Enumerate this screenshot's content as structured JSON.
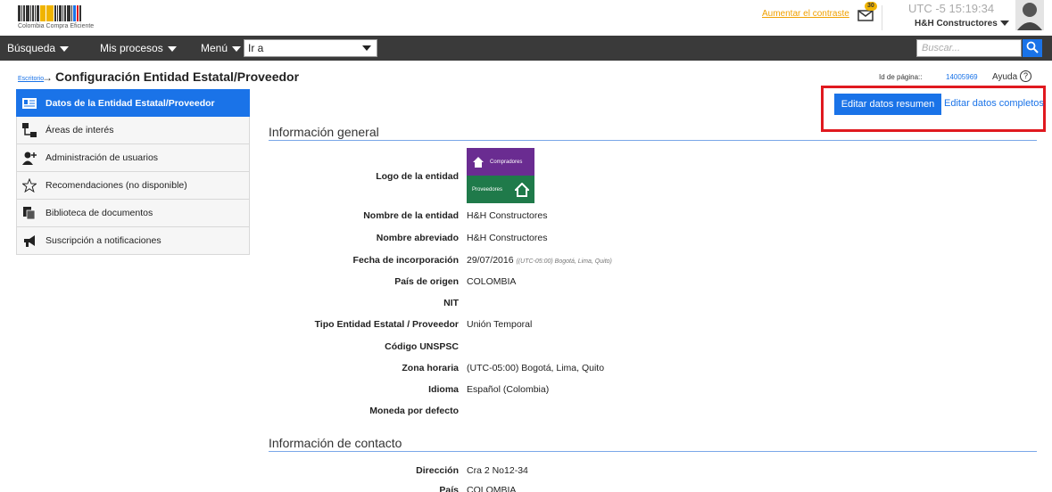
{
  "header": {
    "logo_text": "Colombia Compra Eficiente",
    "contrast_link": "Aumentar el contraste",
    "mail_badge": "30",
    "clock": "UTC -5 15:19:34",
    "user_name": "H&H Constructores"
  },
  "nav": {
    "busqueda": "Búsqueda",
    "mis_procesos": "Mis procesos",
    "menu": "Menú",
    "ir_a": "Ir a",
    "search_placeholder": "Buscar..."
  },
  "breadcrumb": {
    "home": "Escritorio",
    "arrow": "→",
    "title": "Configuración Entidad Estatal/Proveedor"
  },
  "page_meta": {
    "id_label": "Id de página::",
    "id_value": "14005969",
    "help": "Ayuda",
    "help_glyph": "?"
  },
  "sidebar": {
    "items": [
      {
        "label": "Datos de la Entidad Estatal/Proveedor",
        "icon": "id-card-icon"
      },
      {
        "label": "Áreas de interés",
        "icon": "hierarchy-icon"
      },
      {
        "label": "Administración de usuarios",
        "icon": "add-user-icon"
      },
      {
        "label": "Recomendaciones (no disponible)",
        "icon": "star-outline-icon"
      },
      {
        "label": "Biblioteca de documentos",
        "icon": "documents-icon"
      },
      {
        "label": "Suscripción a notificaciones",
        "icon": "megaphone-icon"
      }
    ]
  },
  "actions": {
    "edit_summary": "Editar datos resumen",
    "edit_full": "Editar datos completos"
  },
  "general": {
    "section_title": "Información general",
    "logo_label": "Logo de la entidad",
    "logo_top_text": "Compradores",
    "logo_bottom_text": "Proveedores",
    "fields": [
      {
        "label": "Nombre de la entidad",
        "value": "H&H Constructores"
      },
      {
        "label": "Nombre abreviado",
        "value": "H&H Constructores"
      },
      {
        "label": "Fecha de incorporación",
        "value": "29/07/2016",
        "extra": "((UTC-05:00) Bogotá, Lima, Quito)"
      },
      {
        "label": "País de origen",
        "value": "COLOMBIA"
      },
      {
        "label": "NIT",
        "value": ""
      },
      {
        "label": "Tipo Entidad Estatal / Proveedor",
        "value": "Unión Temporal"
      },
      {
        "label": "Código UNSPSC",
        "value": ""
      },
      {
        "label": "Zona horaria",
        "value": "(UTC-05:00) Bogotá, Lima, Quito"
      },
      {
        "label": "Idioma",
        "value": "Español (Colombia)"
      },
      {
        "label": "Moneda por defecto",
        "value": ""
      }
    ]
  },
  "contact": {
    "section_title": "Información de contacto",
    "fields": [
      {
        "label": "Dirección",
        "value": "Cra 2 No12-34"
      },
      {
        "label": "País",
        "value": "COLOMBIA"
      }
    ]
  }
}
